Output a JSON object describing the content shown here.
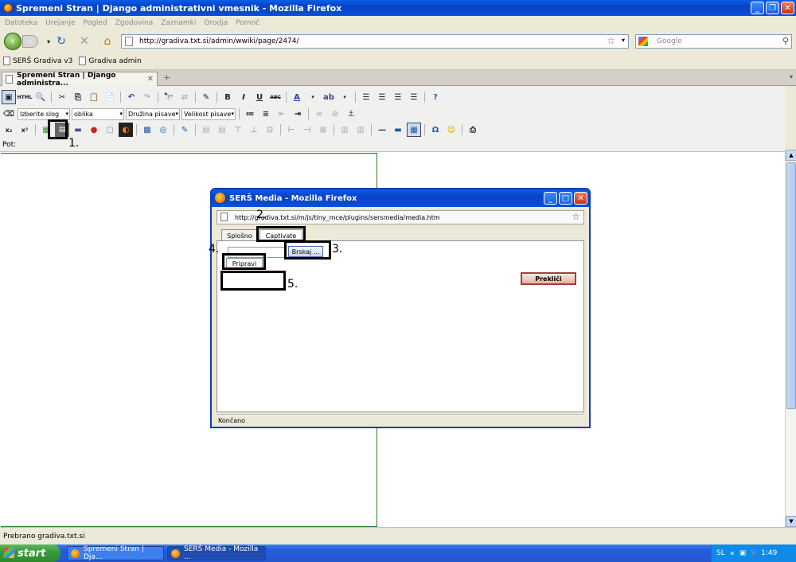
{
  "window": {
    "title": "Spremeni Stran | Django administrativni vmesnik - Mozilla Firefox"
  },
  "menu": [
    "Datoteka",
    "Urejanje",
    "Pogled",
    "Zgodovina",
    "Zaznamki",
    "Orodja",
    "Pomoč"
  ],
  "url": "http://gradiva.txt.si/admin/wwiki/page/2474/",
  "search": {
    "placeholder": "Google"
  },
  "bookmarks": [
    "SERŠ Gradiva v3",
    "Gradiva admin"
  ],
  "tab": {
    "label": "Spremeni Stran | Django administra..."
  },
  "editor": {
    "format_select": "Izberite slog",
    "style_select": "oblika",
    "font_select": "Družina pisave",
    "size_select": "Velikost pisave",
    "path_label": "Pot:"
  },
  "status": "Prebrano gradiva.txt.si",
  "dialog": {
    "title": "SERŠ Media - Mozilla Firefox",
    "url": "http://gradiva.txt.si/m/js/tiny_mce/plugins/sersmedia/media.htm",
    "tabs": [
      "Splošno",
      "Captivate"
    ],
    "browse_label": "Brskaj ...",
    "prepare_label": "Pripravi",
    "cancel_label": "Prekliči",
    "status": "Končano"
  },
  "annotations": [
    "1.",
    "2.",
    "3.",
    "4.",
    "5."
  ],
  "taskbar": {
    "start": "start",
    "tasks": [
      "Spremeni Stran | Dja...",
      "SERŠ Media - Mozilla ..."
    ],
    "lang": "SL",
    "clock": "1:49"
  },
  "colors": {
    "titlebar": "#0a4fd8",
    "green_border": "#2a7a2a",
    "cancel_border": "#a04040"
  }
}
